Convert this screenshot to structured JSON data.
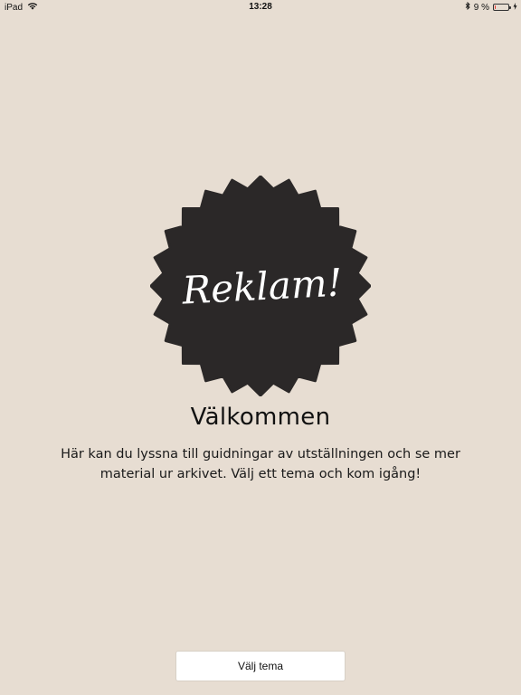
{
  "status_bar": {
    "device": "iPad",
    "time": "13:28",
    "battery_text": "9 %",
    "battery_level": 0.09,
    "battery_color": "#e5322b",
    "icons": [
      "wifi-icon",
      "bluetooth-icon",
      "battery-icon",
      "charging-icon"
    ]
  },
  "badge": {
    "text": "Reklam!",
    "color": "#2b2828",
    "text_color": "#ffffff"
  },
  "welcome": {
    "title": "Välkommen",
    "line1": "Här kan du lyssna till guidningar av utställningen och se mer",
    "line2": "material ur arkivet. Välj ett tema och kom igång!"
  },
  "button": {
    "label": "Välj tema"
  },
  "colors": {
    "background": "#e7ddd2",
    "button_bg": "#ffffff"
  }
}
